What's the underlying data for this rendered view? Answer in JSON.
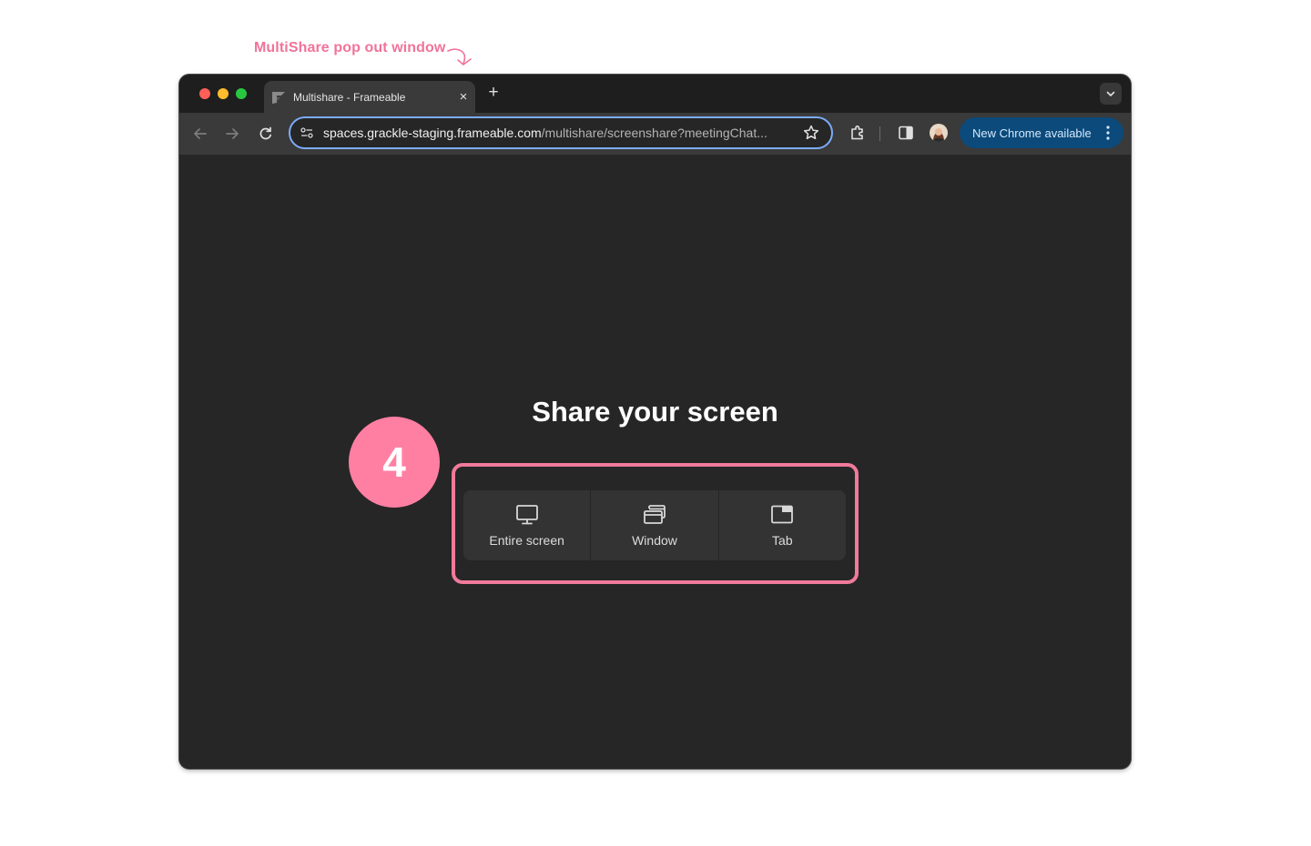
{
  "annotation": {
    "text": "MultiShare pop out window"
  },
  "browser": {
    "tab": {
      "title": "Multishare - Frameable",
      "close_glyph": "×"
    },
    "new_tab_glyph": "+",
    "address_bar": {
      "domain": "spaces.grackle-staging.frameable.com",
      "path": "/multishare/screenshare?meetingChat..."
    },
    "update_button": {
      "label": "New Chrome available"
    }
  },
  "page": {
    "title": "Share your screen",
    "options": [
      {
        "label": "Entire screen",
        "icon": "monitor-icon"
      },
      {
        "label": "Window",
        "icon": "window-icon"
      },
      {
        "label": "Tab",
        "icon": "tab-icon"
      }
    ]
  },
  "step_badge": {
    "number": "4"
  },
  "colors": {
    "accent_pink": "#f07a9b",
    "badge_pink": "#ff7fa3",
    "omnibox_focus": "#7cacf8",
    "update_pill": "#0b4a7a",
    "page_bg": "#262626"
  }
}
